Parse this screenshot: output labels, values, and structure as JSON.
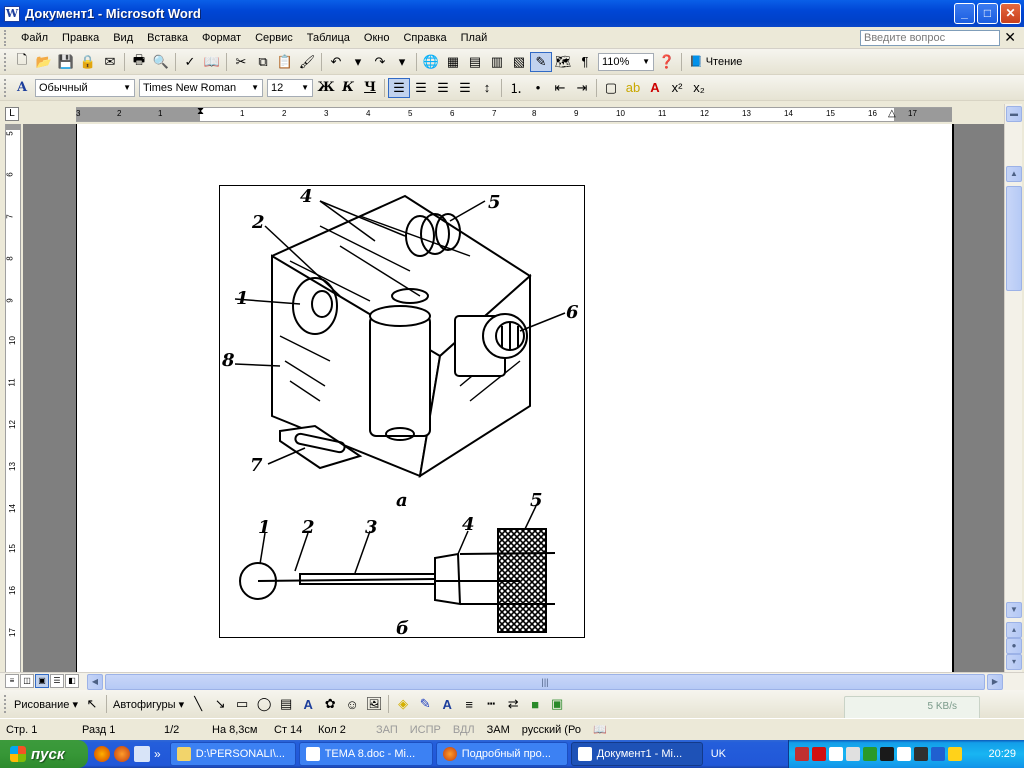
{
  "window": {
    "title": "Документ1 - Microsoft Word",
    "min": "_",
    "max": "□",
    "close": "✕"
  },
  "menu": {
    "items": [
      "Файл",
      "Правка",
      "Вид",
      "Вставка",
      "Формат",
      "Сервис",
      "Таблица",
      "Окно",
      "Справка",
      "Плай"
    ],
    "help_placeholder": "Введите вопрос",
    "close": "✕"
  },
  "standard_toolbar": {
    "zoom": "110%",
    "reading_label": "Чтение"
  },
  "format_toolbar": {
    "style": "Обычный",
    "font": "Times New Roman",
    "size": "12",
    "bold": "Ж",
    "italic": "К",
    "underline": "Ч"
  },
  "ruler": {
    "corner": "L",
    "marks": [
      "3",
      "2",
      "1",
      "1",
      "2",
      "3",
      "4",
      "5",
      "6",
      "7",
      "8",
      "9",
      "10",
      "11",
      "12",
      "13",
      "14",
      "15",
      "16",
      "17"
    ],
    "vmarks": [
      "5",
      "6",
      "7",
      "8",
      "9",
      "10",
      "11",
      "12",
      "13",
      "14",
      "15",
      "16",
      "17"
    ]
  },
  "figure": {
    "label_a": "а",
    "label_b": "б",
    "numbers_a": [
      "1",
      "2",
      "4",
      "5",
      "6",
      "7",
      "8"
    ],
    "numbers_b": [
      "1",
      "2",
      "3",
      "4",
      "5"
    ]
  },
  "drawing_toolbar": {
    "drawing": "Рисование ▾",
    "autoshapes": "Автофигуры ▾"
  },
  "status": {
    "page": "Стр. 1",
    "section": "Разд 1",
    "pages": "1/2",
    "at": "На 8,3см",
    "line": "Ст 14",
    "col": "Кол 2",
    "rec": "ЗАП",
    "trk": "ИСПР",
    "ext": "ВДЛ",
    "ovr": "ЗАМ",
    "lang": "русский (Ро"
  },
  "network": {
    "speed": "5 KB/s"
  },
  "taskbar": {
    "start": "пуск",
    "tasks": [
      "D:\\PERSONALI\\...",
      "TEMA 8.doc - Mi...",
      "Подробный про...",
      "Документ1 - Mi..."
    ],
    "lang": "UK",
    "clock": "20:29"
  },
  "colors": {
    "title_blue": "#0046D5",
    "taskbar_blue": "#245EDB",
    "start_green": "#379737",
    "tray_blue": "#18B5F2"
  }
}
